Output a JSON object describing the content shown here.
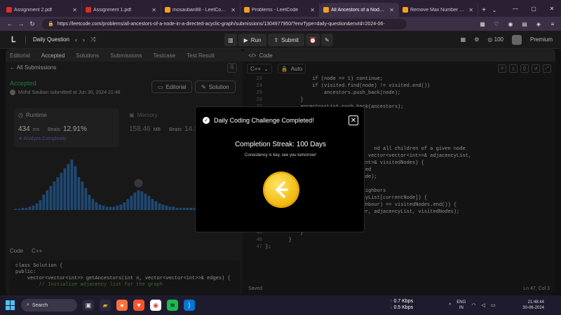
{
  "browser": {
    "tabs": [
      {
        "label": "Assignment 2.pdf",
        "color": "#d93025"
      },
      {
        "label": "Assignment 1.pdf",
        "color": "#d93025"
      },
      {
        "label": "mosauban88 - LeetCode Pr",
        "color": "#f89f1b"
      },
      {
        "label": "Problems - LeetCode",
        "color": "#f89f1b"
      },
      {
        "label": "All Ancestors of a Node in a",
        "color": "#f89f1b"
      },
      {
        "label": "Remove Max Number of Ed",
        "color": "#f89f1b"
      }
    ],
    "url": "https://leetcode.com/problems/all-ancestors-of-a-node-in-a-directed-acyclic-graph/submissions/1304977950/?envType=daily-question&envId=2024-06-"
  },
  "header": {
    "daily_question": "Daily Question",
    "run": "Run",
    "submit": "Submit",
    "coins": "100",
    "premium": "Premium"
  },
  "left": {
    "tabs": [
      "Editorial",
      "Accepted",
      "Solutions",
      "Submissions",
      "Testcase",
      "Test Result"
    ],
    "all_submissions": "All Submissions",
    "status": "Accepted",
    "submitted_by": "Mohd Sauban submitted at Jun 30, 2024 21:48",
    "editorial_btn": "Editorial",
    "solution_btn": "Solution",
    "runtime": {
      "title": "Runtime",
      "value": "434",
      "unit": "ms",
      "beats": "Beats",
      "pct": "12.91%"
    },
    "memory": {
      "title": "Memory",
      "value": "158.46",
      "unit": "MB",
      "beats": "Beats",
      "pct": "14.5"
    },
    "analyze": "Analyze Complexity",
    "code_label": "Code",
    "lang": "C++",
    "code_lines": [
      "class Solution {",
      "public:",
      "    vector<vector<int>> getAncestors(int n, vector<vector<int>>& edges) {",
      "        // Initialize adjacency list for the graph"
    ]
  },
  "chart_data": {
    "type": "bar",
    "values": [
      1,
      1,
      2,
      2,
      3,
      4,
      6,
      9,
      14,
      18,
      22,
      26,
      30,
      34,
      38,
      42,
      46,
      40,
      30,
      26,
      20,
      14,
      10,
      7,
      5,
      4,
      3,
      3,
      3,
      4,
      5,
      7,
      10,
      13,
      16,
      18,
      17,
      15,
      13,
      10,
      8,
      6,
      5,
      4,
      3,
      3,
      2,
      2,
      2,
      2,
      2,
      2,
      2,
      2,
      2,
      2,
      1,
      1,
      1,
      1
    ],
    "highlight_index": 35,
    "color": "#2f6fb2"
  },
  "right": {
    "title": "Code",
    "lang": "C++",
    "auto": "Auto",
    "lines": [
      {
        "n": "23",
        "t": "                if (node == 1) continue;"
      },
      {
        "n": "24",
        "t": "                if (visited.find(node) != visited.end())"
      },
      {
        "n": "25",
        "t": "                    ancestors.push_back(node);"
      },
      {
        "n": "26",
        "t": "            }"
      },
      {
        "n": "27",
        "t": "            ancestorsList.push_back(ancestors);"
      },
      {
        "n": "",
        "t": ""
      },
      {
        "n": "",
        "t": ""
      },
      {
        "n": "",
        "t": ""
      },
      {
        "n": "",
        "t": ""
      },
      {
        "n": "",
        "t": ""
      },
      {
        "n": "",
        "t": "                                     nd all children of a given node"
      },
      {
        "n": "",
        "t": "                                 , vector<vector<int>>& adjacencyList,"
      },
      {
        "n": "",
        "t": "                                 int>& visitedNodes) {"
      },
      {
        "n": "",
        "t": "                                 ted"
      },
      {
        "n": "",
        "t": "                                 ode);"
      },
      {
        "n": "",
        "t": ""
      },
      {
        "n": "",
        "t": "                                 eighbors"
      },
      {
        "n": "",
        "t": "                                 cyList[currentNode]) {"
      },
      {
        "n": "",
        "t": "                                 ghbour) == visitedNodes.end()) {"
      },
      {
        "n": "",
        "t": "                                 ur, adjacencyList, visitedNodes);"
      },
      {
        "n": "",
        "t": ""
      },
      {
        "n": "44",
        "t": "                }"
      },
      {
        "n": "45",
        "t": "            }"
      },
      {
        "n": "46",
        "t": "        }"
      },
      {
        "n": "47",
        "t": "};"
      }
    ],
    "saved": "Saved",
    "position": "Ln 47, Col 3"
  },
  "modal": {
    "title": "Daily Coding Challenge Completed!",
    "streak_label": "Completion Streak:",
    "streak_value": "100",
    "streak_unit": "Days",
    "message": "Consistency is key, see you tomorrow!"
  },
  "taskbar": {
    "search": "Search",
    "net_up": "0.7 Kbps",
    "net_down": "0.5 Kbps",
    "lang1": "ENG",
    "lang2": "IN",
    "time": "21:48:44",
    "date": "30-06-2024"
  }
}
